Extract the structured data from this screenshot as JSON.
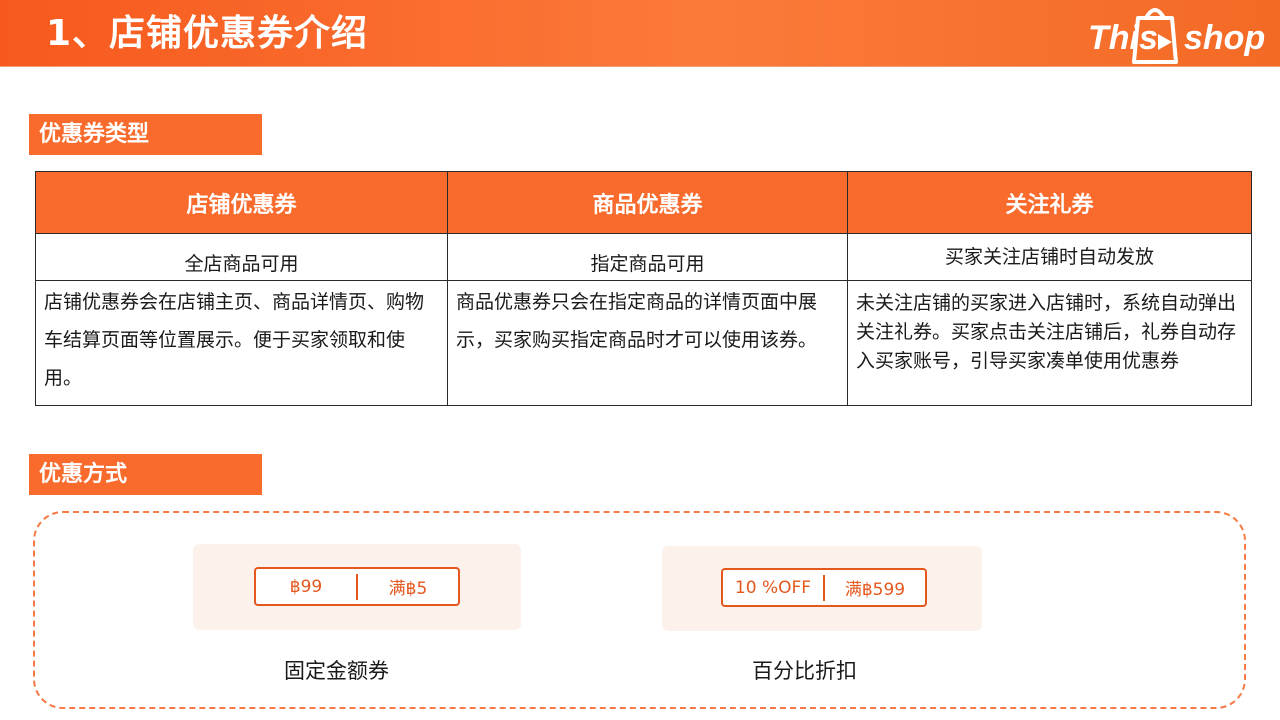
{
  "header": {
    "title": "1、店铺优惠券介绍",
    "logo": {
      "part1": "This",
      "part2": "shop"
    }
  },
  "sections": {
    "types_label": "优惠券类型",
    "methods_label": "优惠方式"
  },
  "table": {
    "headers": [
      "店铺优惠券",
      "商品优惠券",
      "关注礼券"
    ],
    "subtitles": [
      "全店商品可用",
      "指定商品可用",
      "买家关注店铺时自动发放"
    ],
    "descriptions": [
      "店铺优惠券会在店铺主页、商品详情页、购物车结算页面等位置展示。便于买家领取和使用。",
      "商品优惠券只会在指定商品的详情页面中展示，买家购买指定商品时才可以使用该券。",
      "未关注店铺的买家进入店铺时，系统自动弹出关注礼券。买家点击关注店铺后，礼券自动存入买家账号，引导买家凑单使用优惠券"
    ]
  },
  "methods": [
    {
      "left": "฿99",
      "right": "满฿5",
      "caption": "固定金额券"
    },
    {
      "left": "10 %OFF",
      "right": "满฿599",
      "caption": "百分比折扣"
    }
  ],
  "colors": {
    "accent": "#f96b2c",
    "chip": "#e4581e",
    "card_bg": "#fdf1ec"
  }
}
